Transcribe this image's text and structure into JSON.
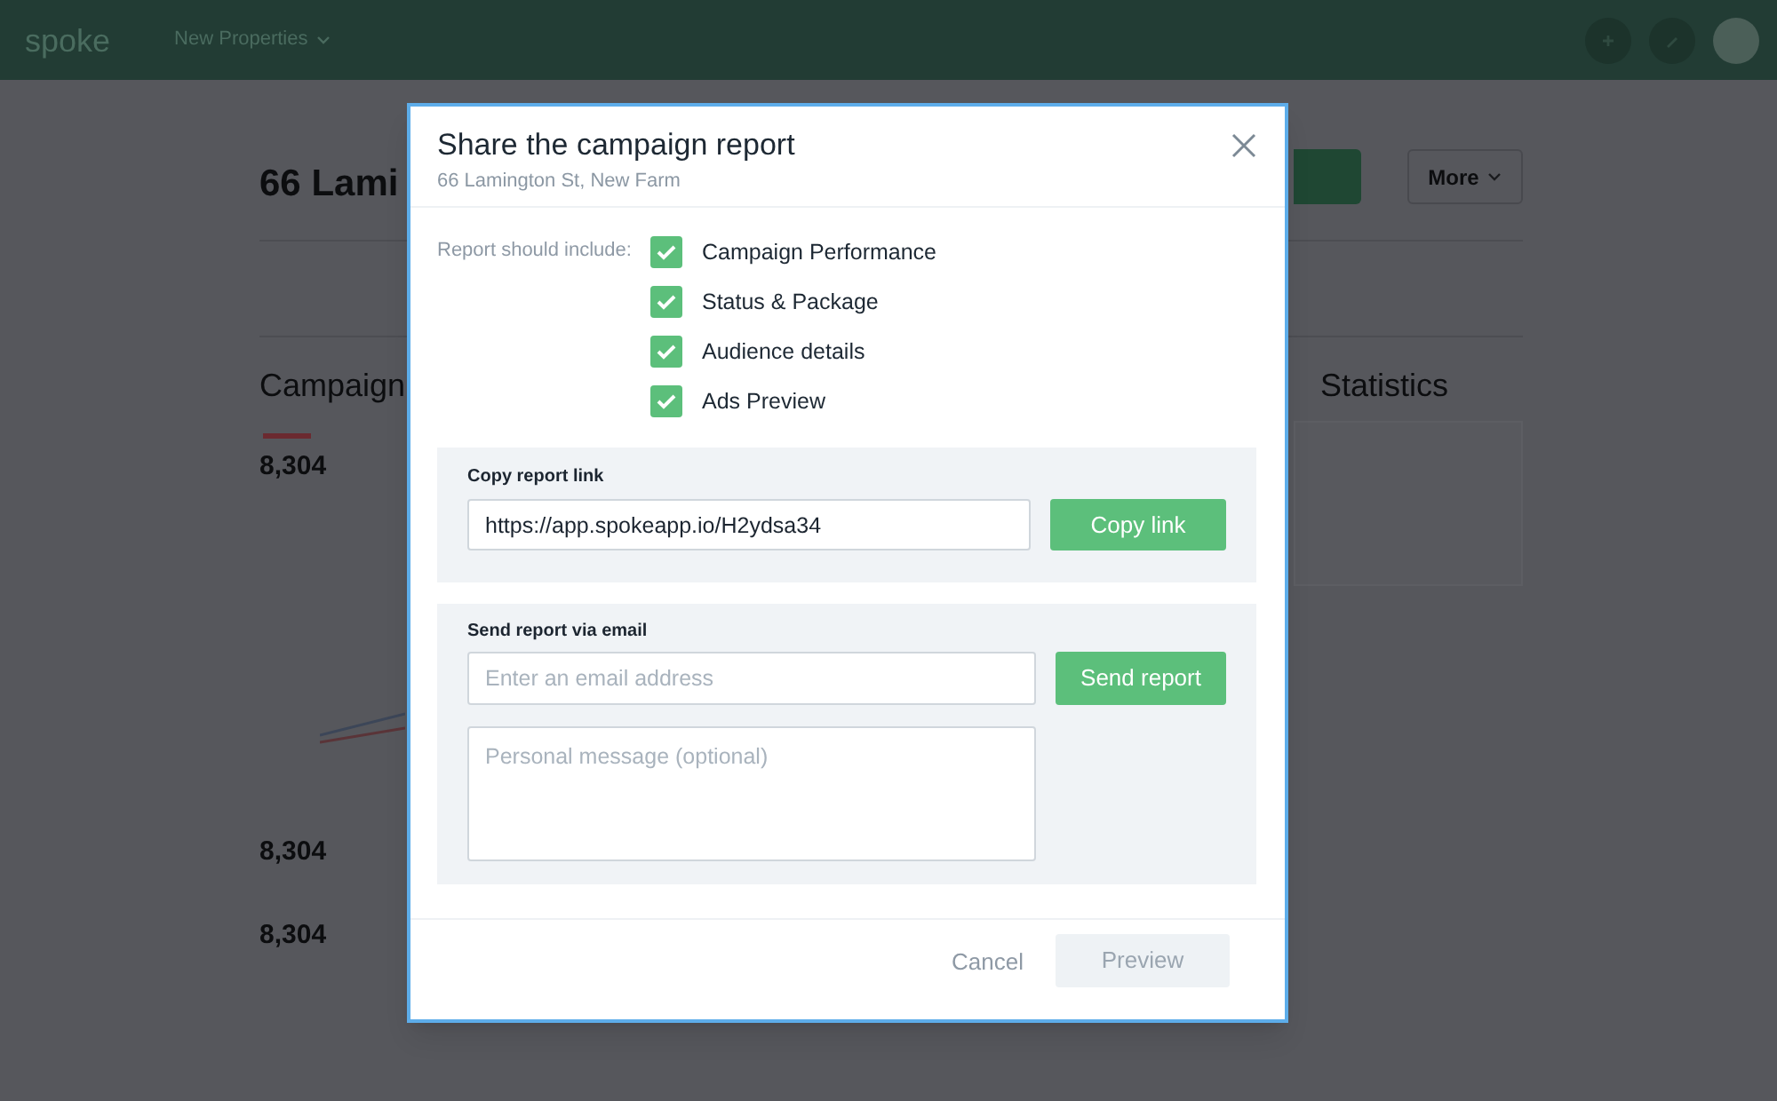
{
  "header": {
    "logo": "spoke",
    "nav": {
      "label": "New Properties"
    }
  },
  "page": {
    "title": "66 Lami",
    "more_button": "More",
    "campaign_heading": "Campaign",
    "metrics": [
      {
        "value": "8,304"
      },
      {
        "value": "8,304"
      },
      {
        "value": "8,304"
      }
    ],
    "statistics_heading": "Statistics"
  },
  "modal": {
    "title": "Share the campaign report",
    "subtitle": "66 Lamington St, New Farm",
    "include_label": "Report should include:",
    "options": [
      {
        "label": "Campaign Performance",
        "checked": true
      },
      {
        "label": "Status & Package",
        "checked": true
      },
      {
        "label": "Audience details",
        "checked": true
      },
      {
        "label": "Ads Preview",
        "checked": true
      }
    ],
    "copy_link": {
      "label": "Copy report link",
      "value": "https://app.spokeapp.io/H2ydsa34",
      "button": "Copy link"
    },
    "email": {
      "label": "Send report via email",
      "placeholder": "Enter an email address",
      "button": "Send report",
      "message_placeholder": "Personal message (optional)"
    },
    "footer": {
      "cancel": "Cancel",
      "preview": {
        "label": "Preview",
        "disabled": true
      }
    }
  }
}
